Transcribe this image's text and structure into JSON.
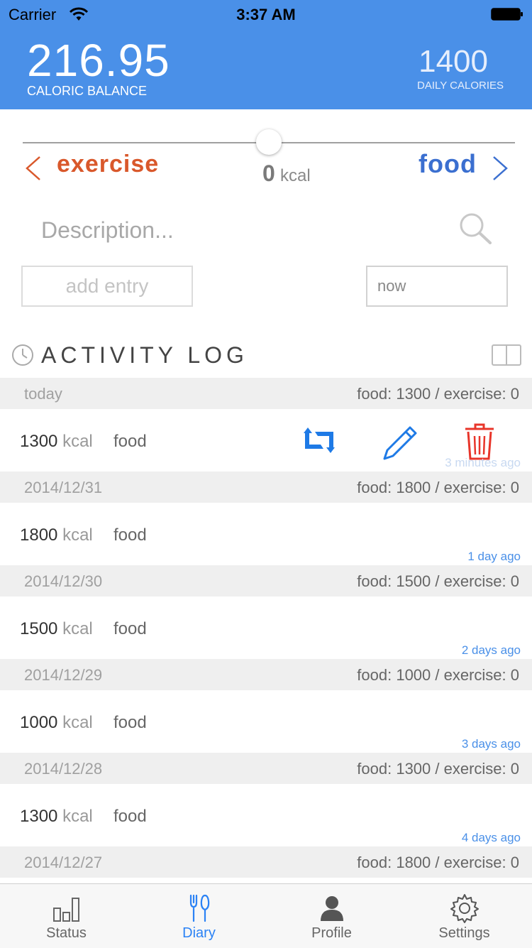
{
  "status_bar": {
    "carrier": "Carrier",
    "time": "3:37 AM"
  },
  "header": {
    "balance_value": "216.95",
    "balance_label": "CALORIC BALANCE",
    "daily_value": "1400",
    "daily_label": "DAILY CALORIES"
  },
  "entry_form": {
    "exercise_label": "exercise",
    "food_label": "food",
    "kcal_value": "0",
    "kcal_unit": "kcal",
    "slider_level": 0.5,
    "description_placeholder": "Description...",
    "add_entry_label": "add entry",
    "time_value": "now"
  },
  "activity_log": {
    "title": "ACTIVITY LOG",
    "days": [
      {
        "date": "today",
        "summary": "food: 1300 / exercise: 0",
        "entry": {
          "kcal": "1300",
          "unit": "kcal",
          "type": "food",
          "ago": "3 minutes ago"
        }
      },
      {
        "date": "2014/12/31",
        "summary": "food: 1800 / exercise: 0",
        "entry": {
          "kcal": "1800",
          "unit": "kcal",
          "type": "food",
          "ago": "1 day ago"
        }
      },
      {
        "date": "2014/12/30",
        "summary": "food: 1500 / exercise: 0",
        "entry": {
          "kcal": "1500",
          "unit": "kcal",
          "type": "food",
          "ago": "2 days ago"
        }
      },
      {
        "date": "2014/12/29",
        "summary": "food: 1000 / exercise: 0",
        "entry": {
          "kcal": "1000",
          "unit": "kcal",
          "type": "food",
          "ago": "3 days ago"
        }
      },
      {
        "date": "2014/12/28",
        "summary": "food: 1300 / exercise: 0",
        "entry": {
          "kcal": "1300",
          "unit": "kcal",
          "type": "food",
          "ago": "4 days ago"
        }
      },
      {
        "date": "2014/12/27",
        "summary": "food: 1800 / exercise: 0"
      }
    ]
  },
  "tabbar": {
    "status": "Status",
    "diary": "Diary",
    "profile": "Profile",
    "settings": "Settings",
    "active_tab": "diary"
  },
  "colors": {
    "header_bg": "#4a90e8",
    "exercise": "#d9582b",
    "food": "#3b6fd0",
    "accent": "#2b82f5",
    "delete": "#e8352a"
  }
}
